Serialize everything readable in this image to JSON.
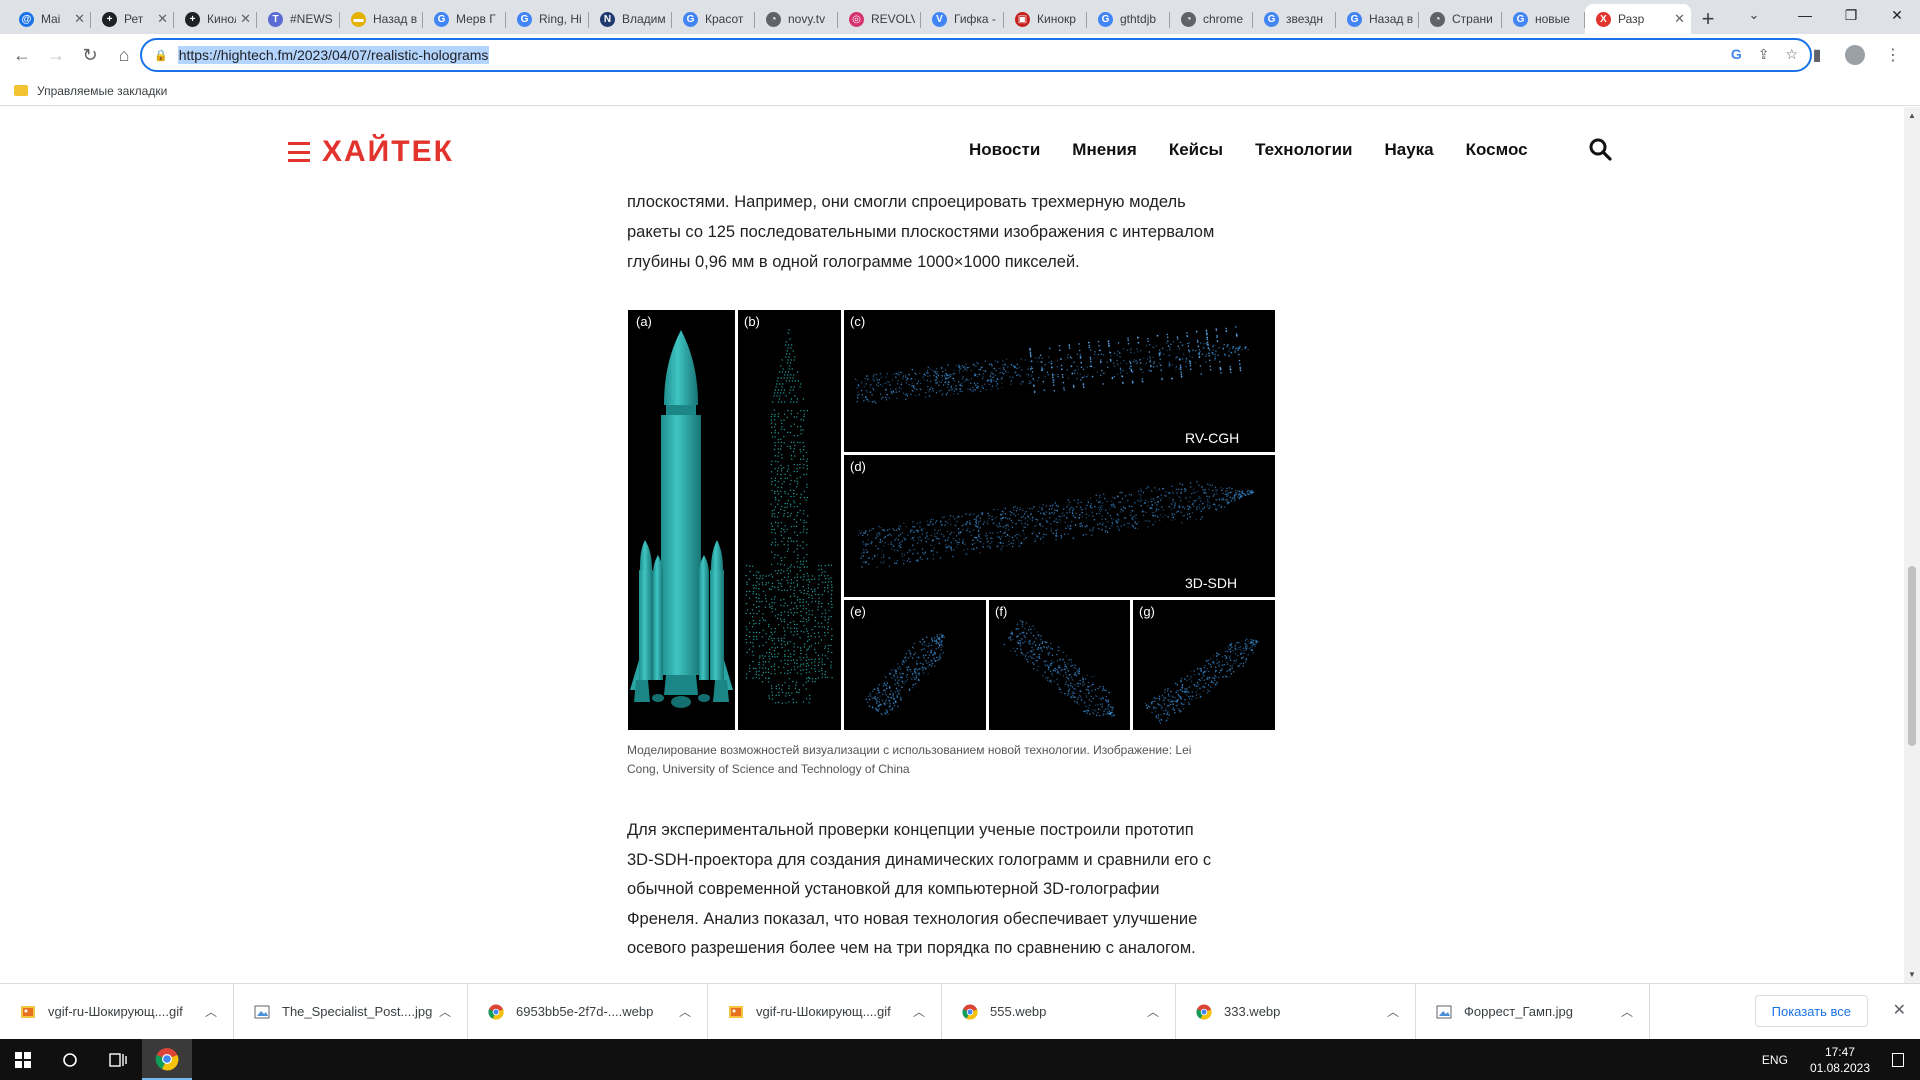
{
  "tabs": [
    {
      "title": "Mai",
      "color": "#1a73e8",
      "glyph": "@"
    },
    {
      "title": "Рет",
      "color": "#202124",
      "glyph": "+"
    },
    {
      "title": "Киноля",
      "color": "#202124",
      "glyph": "+"
    },
    {
      "title": "#NEWS",
      "color": "#5b6bd5",
      "glyph": "T"
    },
    {
      "title": "Назад в",
      "color": "#e5b100",
      "glyph": "▬"
    },
    {
      "title": "Мерв Г",
      "color": "#4285f4",
      "glyph": "G"
    },
    {
      "title": "Ring, Hi",
      "color": "#4285f4",
      "glyph": "G"
    },
    {
      "title": "Владим",
      "color": "#1f3a6e",
      "glyph": "N"
    },
    {
      "title": "Красот",
      "color": "#4285f4",
      "glyph": "G"
    },
    {
      "title": "novy.tv",
      "color": "#5f6368",
      "glyph": "◔"
    },
    {
      "title": "REVOLV",
      "color": "#d6336c",
      "glyph": "◎"
    },
    {
      "title": "Гифка -",
      "color": "#4285f4",
      "glyph": "V"
    },
    {
      "title": "Кинокр",
      "color": "#c5221f",
      "glyph": "▣"
    },
    {
      "title": "gthtdjb",
      "color": "#4285f4",
      "glyph": "G"
    },
    {
      "title": "chrome",
      "color": "#5f6368",
      "glyph": "◔"
    },
    {
      "title": "звездн",
      "color": "#4285f4",
      "glyph": "G"
    },
    {
      "title": "Назад в",
      "color": "#4285f4",
      "glyph": "G"
    },
    {
      "title": "Страни",
      "color": "#5f6368",
      "glyph": "◔"
    },
    {
      "title": "новые",
      "color": "#4285f4",
      "glyph": "G"
    }
  ],
  "active_tab": {
    "title": "Разр",
    "color": "#e2332c",
    "glyph": "X"
  },
  "omnibox": {
    "url": "https://hightech.fm/2023/04/07/realistic-holograms"
  },
  "bookmarks": {
    "managed": "Управляемые закладки"
  },
  "site": {
    "logo": "ХАЙТЕК",
    "menu": [
      "Новости",
      "Мнения",
      "Кейсы",
      "Технологии",
      "Наука",
      "Космос"
    ]
  },
  "article": {
    "para1_lines": [
      "плоскостями. Например, они смогли спроецировать трехмерную модель",
      "ракеты со 125 последовательными плоскостями изображения с интервалом",
      "глубины 0,96 мм в одной голограмме 1000×1000 пикселей."
    ],
    "figure": {
      "labels": [
        "(a)",
        "(b)",
        "(c)",
        "(d)",
        "(e)",
        "(f)",
        "(g)"
      ],
      "method_c": "RV-CGH",
      "method_d": "3D-SDH",
      "model_color": "#26a8a8",
      "points_color": "#3d8fd6"
    },
    "caption_lines": [
      "Моделирование возможностей визуализации с использованием новой технологии. Изображение: Lei",
      "Cong, University of Science and Technology of China"
    ],
    "para2_lines": [
      "Для экспериментальной проверки концепции ученые построили прототип",
      "3D-SDH-проектора для создания динамических голограмм и сравнили его с",
      "обычной современной установкой для компьютерной 3D-голографии",
      "Френеля. Анализ показал, что новая технология обеспечивает улучшение",
      "осевого разрешения более чем на три порядка по сравнению с аналогом."
    ]
  },
  "downloads": [
    {
      "name": "vgif-ru-Шокирующ....gif",
      "icon": "gif"
    },
    {
      "name": "The_Specialist_Post....jpg",
      "icon": "img"
    },
    {
      "name": "6953bb5e-2f7d-....webp",
      "icon": "chrome"
    },
    {
      "name": "vgif-ru-Шокирующ....gif",
      "icon": "gif"
    },
    {
      "name": "555.webp",
      "icon": "chrome"
    },
    {
      "name": "333.webp",
      "icon": "chrome"
    },
    {
      "name": "Форрест_Гамп.jpg",
      "icon": "img"
    }
  ],
  "download_bar": {
    "show_all": "Показать все"
  },
  "taskbar": {
    "lang": "ENG",
    "time": "17:47",
    "date": "01.08.2023"
  }
}
